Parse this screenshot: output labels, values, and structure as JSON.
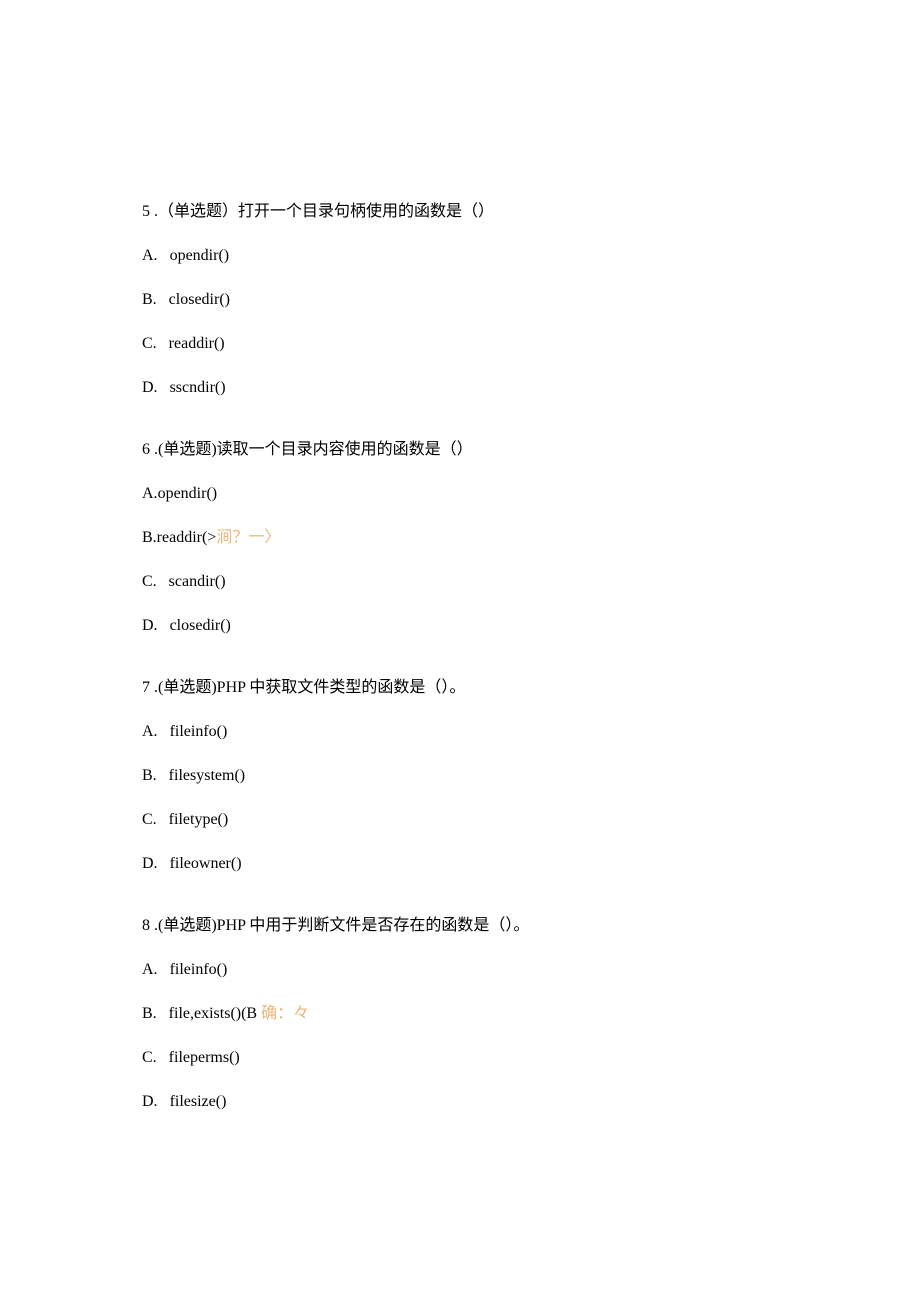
{
  "questions": [
    {
      "number": "5",
      "sep": " .",
      "prompt_prefix": "（单选题）",
      "prompt": "打开一个目录句柄使用的函数是（）",
      "options": [
        {
          "letter": "A.",
          "text": "opendir()",
          "spaced": true
        },
        {
          "letter": "B.",
          "text": "closedir()",
          "spaced": true
        },
        {
          "letter": "C.",
          "text": "readdir()",
          "spaced": true
        },
        {
          "letter": "D.",
          "text": "sscndir()",
          "spaced": true
        }
      ]
    },
    {
      "number": "6",
      "sep": " .",
      "prompt_prefix": "(单选题)",
      "prompt": "读取一个目录内容使用的函数是（）",
      "options": [
        {
          "letter": "A.",
          "text": "opendir()",
          "spaced": false
        },
        {
          "letter": "B.",
          "text": "readdir(>",
          "spaced": false,
          "annotation": "涧？一〉"
        },
        {
          "letter": "C.",
          "text": "scandir()",
          "spaced": true
        },
        {
          "letter": "D.",
          "text": "closedir()",
          "spaced": true
        }
      ]
    },
    {
      "number": "7",
      "sep": " .",
      "prompt_prefix": "(单选题)",
      "prompt": "PHP 中获取文件类型的函数是（）。",
      "options": [
        {
          "letter": "A.",
          "text": "fileinfo()",
          "spaced": true
        },
        {
          "letter": "B.",
          "text": "filesystem()",
          "spaced": true
        },
        {
          "letter": "C.",
          "text": "filetype()",
          "spaced": true
        },
        {
          "letter": "D.",
          "text": "fileowner()",
          "spaced": true
        }
      ]
    },
    {
      "number": "8",
      "sep": " .",
      "prompt_prefix": "(单选题)",
      "prompt": "PHP 中用于判断文件是否存在的函数是（）。",
      "options": [
        {
          "letter": "A.",
          "text": "fileinfo()",
          "spaced": true
        },
        {
          "letter": "B.",
          "text": "file,exists()(B ",
          "spaced": true,
          "annotation": "确：々"
        },
        {
          "letter": "C.",
          "text": "fileperms()",
          "spaced": true
        },
        {
          "letter": "D.",
          "text": "filesize()",
          "spaced": true
        }
      ]
    }
  ]
}
